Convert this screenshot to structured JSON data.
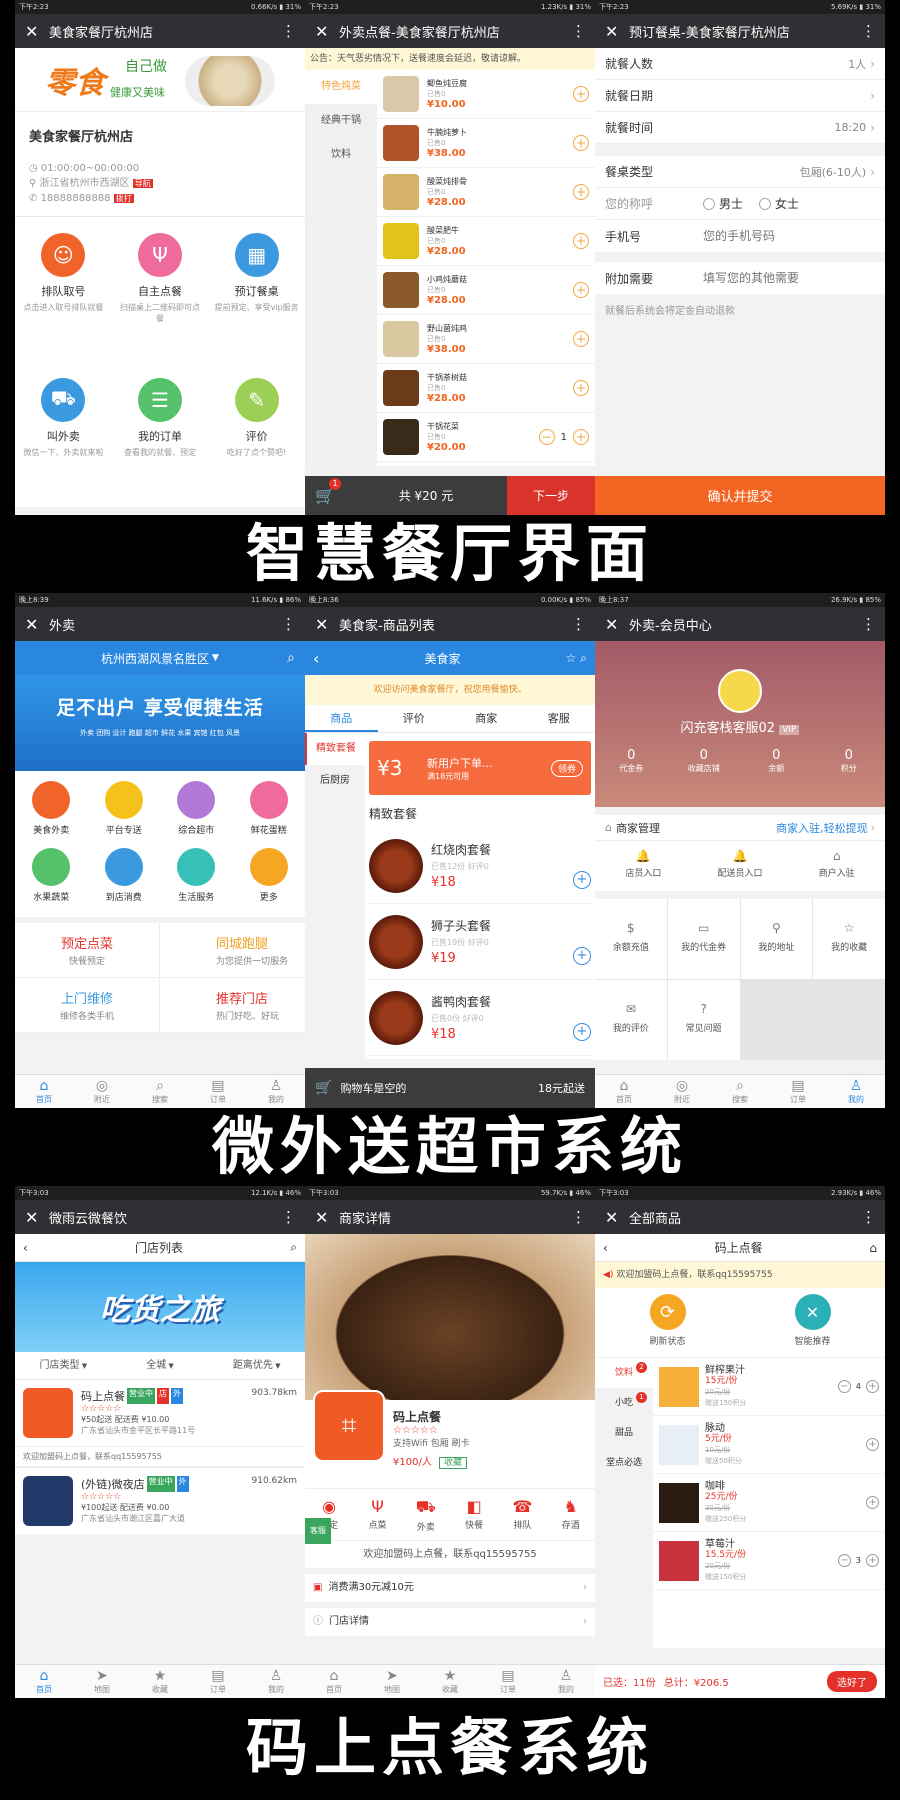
{
  "captions": [
    "智慧餐厅界面",
    "微外送超市系统",
    "码上点餐系统"
  ],
  "row1": {
    "p1": {
      "status": {
        "time": "下午2:23",
        "net": "0.66K/s",
        "bat": "31%"
      },
      "title": "美食家餐厅杭州店",
      "banner_big": "零食",
      "banner_sub": "自己做",
      "banner_sub2": "健康又美味",
      "shop_name": "美食家餐厅杭州店",
      "hours": "01:00:00~00:00:00",
      "address": "浙江省杭州市西湖区",
      "nav_badge": "导航",
      "phone": "18888888888",
      "dial_badge": "拨打",
      "features": [
        {
          "label": "排队取号",
          "desc": "点击进入取号排队就餐",
          "icon": "people-icon",
          "color": "#f0642a"
        },
        {
          "label": "自主点餐",
          "desc": "扫描桌上二维码即可点餐",
          "icon": "fork-knife-icon",
          "color": "#ee6b9b"
        },
        {
          "label": "预订餐桌",
          "desc": "提前预定、享受vip服务",
          "icon": "calendar-icon",
          "color": "#3b99e0"
        },
        {
          "label": "叫外卖",
          "desc": "微信一下、外卖就来啦",
          "icon": "scooter-icon",
          "color": "#3b99e0"
        },
        {
          "label": "我的订单",
          "desc": "查看我的就餐、预定",
          "icon": "list-icon",
          "color": "#55c16a"
        },
        {
          "label": "评价",
          "desc": "吃好了点个赞吧!",
          "icon": "chat-icon",
          "color": "#9ccf55"
        }
      ]
    },
    "p2": {
      "status": {
        "time": "下午2:23",
        "net": "1.23K/s",
        "bat": "31%"
      },
      "title": "外卖点餐-美食家餐厅杭州店",
      "notice": "公告：天气恶劣情况下，送餐速度会延迟，敬请谅解。",
      "categories": [
        "特色炖菜",
        "经典干锅",
        "饮料"
      ],
      "items": [
        {
          "name": "鲫鱼炖豆腐",
          "sold": "已售0",
          "price": "¥10.00",
          "qty": ""
        },
        {
          "name": "牛腩炖萝卜",
          "sold": "已售0",
          "price": "¥38.00",
          "qty": ""
        },
        {
          "name": "酸菜炖排骨",
          "sold": "已售0",
          "price": "¥28.00",
          "qty": ""
        },
        {
          "name": "酸菜肥牛",
          "sold": "已售0",
          "price": "¥28.00",
          "qty": ""
        },
        {
          "name": "小鸡炖蘑菇",
          "sold": "已售0",
          "price": "¥28.00",
          "qty": ""
        },
        {
          "name": "野山菌炖鸡",
          "sold": "已售0",
          "price": "¥38.00",
          "qty": ""
        },
        {
          "name": "干锅茶树菇",
          "sold": "已售0",
          "price": "¥28.00",
          "qty": ""
        },
        {
          "name": "干锅花菜",
          "sold": "已售0",
          "price": "¥20.00",
          "qty": "1"
        }
      ],
      "cart_badge": "1",
      "total": "共 ¥20 元",
      "next": "下一步"
    },
    "p3": {
      "status": {
        "time": "下午2:23",
        "net": "5.69K/s",
        "bat": "31%"
      },
      "title": "预订餐桌-美食家餐厅杭州店",
      "rows1": [
        {
          "label": "就餐人数",
          "value": "1人"
        },
        {
          "label": "就餐日期",
          "value": ""
        },
        {
          "label": "就餐时间",
          "value": "18:20"
        }
      ],
      "table_type_label": "餐桌类型",
      "table_type_value": "包厢(6-10人)",
      "salutation_label": "您的称呼",
      "male": "男士",
      "female": "女士",
      "phone_label": "手机号",
      "phone_placeholder": "您的手机号码",
      "extra_label": "附加需要",
      "extra_placeholder": "填写您的其他需要",
      "note": "就餐后系统会将定金自动退款",
      "submit": "确认并提交"
    }
  },
  "row2": {
    "p1": {
      "status": {
        "time": "晚上8:39",
        "net": "11.6K/s",
        "bat": "86%"
      },
      "title": "外卖",
      "location": "杭州西湖风景名胜区",
      "banner_title": "足不出户 享受便捷生活",
      "banner_sub": "外卖 团购 设计 跑腿 超市 鲜花 水果 宾馆 红包 风景",
      "cats": [
        {
          "label": "美食外卖",
          "color": "#f0642a"
        },
        {
          "label": "平台专送",
          "color": "#f5c21b"
        },
        {
          "label": "综合超市",
          "color": "#b27ad6"
        },
        {
          "label": "鲜花蛋糕",
          "color": "#ee6b9b"
        },
        {
          "label": "水果蔬菜",
          "color": "#55c16a"
        },
        {
          "label": "到店消费",
          "color": "#3b99e0"
        },
        {
          "label": "生活服务",
          "color": "#36c0b8"
        },
        {
          "label": "更多",
          "color": "#f5a623"
        }
      ],
      "promos": [
        {
          "title": "预定点菜",
          "sub": "快餐预定",
          "color": "#e4322b"
        },
        {
          "title": "同城跑腿",
          "sub": "为您提供一切服务",
          "color": "#f0a020"
        },
        {
          "title": "上门维修",
          "sub": "维修各类手机",
          "color": "#3b99e0"
        },
        {
          "title": "推荐门店",
          "sub": "热门好吃、好玩",
          "color": "#e4322b"
        }
      ],
      "tabs": [
        "首页",
        "附近",
        "搜索",
        "订单",
        "我的"
      ]
    },
    "p2": {
      "status": {
        "time": "晚上8:36",
        "net": "0.00K/s",
        "bat": "85%"
      },
      "title": "美食家-商品列表",
      "store": "美食家",
      "welcome": "欢迎访问美食家餐厅，祝您用餐愉快。",
      "tabs": [
        "商品",
        "评价",
        "商家",
        "客服"
      ],
      "sidecats": [
        "精致套餐",
        "后厨房"
      ],
      "coupon_value": "3",
      "coupon_title": "新用户下单...",
      "coupon_sub": "满18元可用",
      "coupon_btn": "领券",
      "section": "精致套餐",
      "items": [
        {
          "name": "红烧肉套餐",
          "meta": "已售12份  好评0",
          "price": "¥18"
        },
        {
          "name": "狮子头套餐",
          "meta": "已售19份  好评0",
          "price": "¥19"
        },
        {
          "name": "酱鸭肉套餐",
          "meta": "已售0份  好评0",
          "price": "¥18"
        }
      ],
      "cart_text": "购物车是空的",
      "min": "18元起送"
    },
    "p3": {
      "status": {
        "time": "晚上8:37",
        "net": "26.9K/s",
        "bat": "85%"
      },
      "title": "外卖-会员中心",
      "user": "闪充客栈客服02",
      "vip": "VIP",
      "stats": [
        {
          "v": "0",
          "l": "代金券"
        },
        {
          "v": "0",
          "l": "收藏店铺"
        },
        {
          "v": "0",
          "l": "余额"
        },
        {
          "v": "0",
          "l": "积分"
        }
      ],
      "merchant_label": "商家管理",
      "merchant_link": "商家入驻,轻松提现",
      "entries": [
        "店员入口",
        "配送员入口",
        "商户入驻"
      ],
      "grid": [
        "余额充值",
        "我的代金券",
        "我的地址",
        "我的收藏",
        "我的评价",
        "常见问题"
      ],
      "tabs": [
        "首页",
        "附近",
        "搜索",
        "订单",
        "我的"
      ]
    }
  },
  "row3": {
    "p1": {
      "status": {
        "time": "下午3:03",
        "net": "12.1K/s",
        "bat": "46%"
      },
      "title": "微雨云微餐饮",
      "header": "门店列表",
      "banner": "吃货之旅",
      "filters": [
        "门店类型",
        "全城",
        "距离优先"
      ],
      "stores": [
        {
          "name": "码上点餐",
          "tags": [
            "营业中",
            "店",
            "外"
          ],
          "dist": "903.78km",
          "fee": "¥50起送  配送费 ¥10.00",
          "addr": "广东省汕头市金平区长平路11号"
        },
        {
          "name": "(外链)微夜店",
          "tags": [
            "营业中",
            "外"
          ],
          "dist": "910.62km",
          "fee": "¥100起送  配送费 ¥0.00",
          "addr": "广东省汕头市潮江区嘉广大道"
        }
      ],
      "store_note": "欢迎加盟码上点餐，联系qq15595755",
      "tabs": [
        "首页",
        "地图",
        "收藏",
        "订单",
        "我的"
      ]
    },
    "p2": {
      "status": {
        "time": "下午3:03",
        "net": "59.7K/s",
        "bat": "46%"
      },
      "title": "商家详情",
      "shop": "码上点餐",
      "stars": "☆☆☆☆☆",
      "amenities": "支持Wifi  包厢  刷卡",
      "price": "¥100/人",
      "fav": "收藏",
      "actions": [
        "预定",
        "点菜",
        "外卖",
        "快餐",
        "排队",
        "存酒"
      ],
      "kefu": "客服",
      "note": "欢迎加盟码上点餐，联系qq15595755",
      "promo": "消费满30元减10元",
      "detail": "门店详情",
      "tabs": [
        "首页",
        "地图",
        "收藏",
        "订单",
        "我的"
      ]
    },
    "p3": {
      "status": {
        "time": "下午3:03",
        "net": "2.93K/s",
        "bat": "46%"
      },
      "title": "全部商品",
      "header": "码上点餐",
      "notice": "欢迎加盟码上点餐，联系qq15595755",
      "refresh": "刷新状态",
      "recommend": "智能推荐",
      "side": [
        {
          "label": "饮料",
          "badge": "2"
        },
        {
          "label": "小吃",
          "badge": "1"
        },
        {
          "label": "甜品",
          "badge": ""
        },
        {
          "label": "堂点必选",
          "badge": ""
        }
      ],
      "items": [
        {
          "name": "鲜榨果汁",
          "price": "15元/份",
          "old": "20元/份",
          "give": "赠送150积分",
          "qty": "4"
        },
        {
          "name": "脉动",
          "price": "5元/份",
          "old": "10元/份",
          "give": "赠送50积分",
          "qty": ""
        },
        {
          "name": "咖啡",
          "price": "25元/份",
          "old": "30元/份",
          "give": "赠送250积分",
          "qty": ""
        },
        {
          "name": "草莓汁",
          "price": "15.5元/份",
          "old": "20元/份",
          "give": "赠送150积分",
          "qty": "3"
        }
      ],
      "selected": "已选：11份",
      "total": "总计：¥206.5",
      "done": "选好了"
    }
  }
}
